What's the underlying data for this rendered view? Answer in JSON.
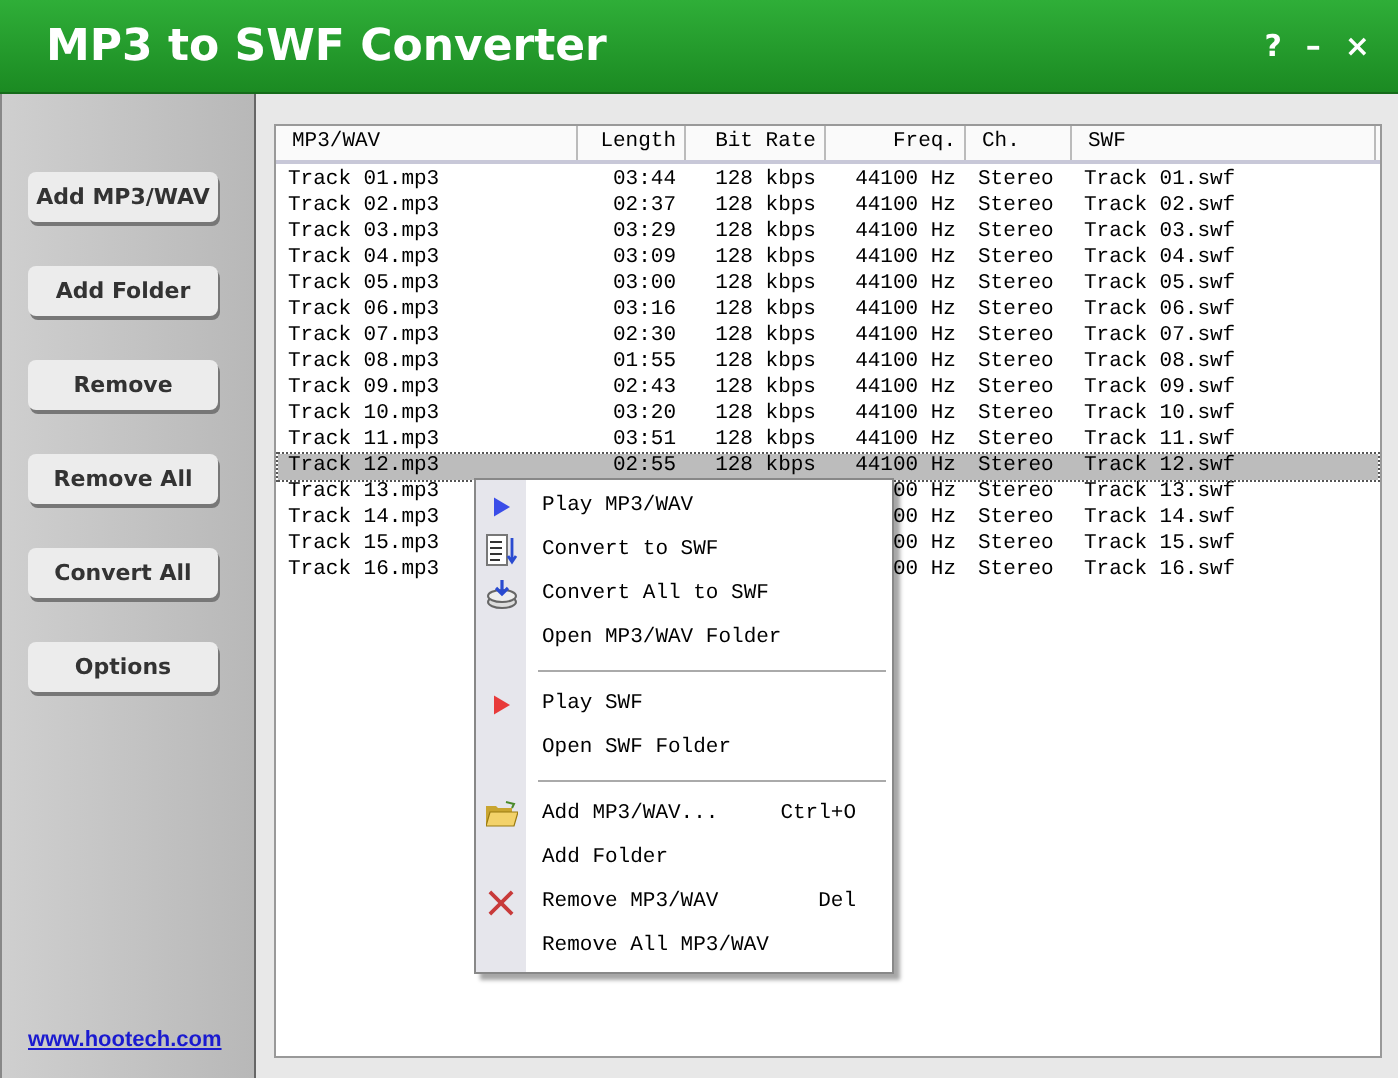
{
  "window": {
    "title": "MP3 to SWF Converter",
    "controls": [
      "?",
      "–",
      "×"
    ]
  },
  "sidebar": {
    "buttons": [
      "Add MP3/WAV",
      "Add Folder",
      "Remove",
      "Remove All",
      "Convert All",
      "Options"
    ],
    "link": "www.hootech.com"
  },
  "table": {
    "columns": [
      "MP3/WAV",
      "Length",
      "Bit Rate",
      "Freq.",
      "Ch.",
      "SWF"
    ],
    "rows": [
      {
        "selected": false,
        "cells": [
          "Track 01.mp3",
          "03:44",
          "128 kbps",
          "44100 Hz",
          "Stereo",
          "Track 01.swf"
        ]
      },
      {
        "selected": false,
        "cells": [
          "Track 02.mp3",
          "02:37",
          "128 kbps",
          "44100 Hz",
          "Stereo",
          "Track 02.swf"
        ]
      },
      {
        "selected": false,
        "cells": [
          "Track 03.mp3",
          "03:29",
          "128 kbps",
          "44100 Hz",
          "Stereo",
          "Track 03.swf"
        ]
      },
      {
        "selected": false,
        "cells": [
          "Track 04.mp3",
          "03:09",
          "128 kbps",
          "44100 Hz",
          "Stereo",
          "Track 04.swf"
        ]
      },
      {
        "selected": false,
        "cells": [
          "Track 05.mp3",
          "03:00",
          "128 kbps",
          "44100 Hz",
          "Stereo",
          "Track 05.swf"
        ]
      },
      {
        "selected": false,
        "cells": [
          "Track 06.mp3",
          "03:16",
          "128 kbps",
          "44100 Hz",
          "Stereo",
          "Track 06.swf"
        ]
      },
      {
        "selected": false,
        "cells": [
          "Track 07.mp3",
          "02:30",
          "128 kbps",
          "44100 Hz",
          "Stereo",
          "Track 07.swf"
        ]
      },
      {
        "selected": false,
        "cells": [
          "Track 08.mp3",
          "01:55",
          "128 kbps",
          "44100 Hz",
          "Stereo",
          "Track 08.swf"
        ]
      },
      {
        "selected": false,
        "cells": [
          "Track 09.mp3",
          "02:43",
          "128 kbps",
          "44100 Hz",
          "Stereo",
          "Track 09.swf"
        ]
      },
      {
        "selected": false,
        "cells": [
          "Track 10.mp3",
          "03:20",
          "128 kbps",
          "44100 Hz",
          "Stereo",
          "Track 10.swf"
        ]
      },
      {
        "selected": false,
        "cells": [
          "Track 11.mp3",
          "03:51",
          "128 kbps",
          "44100 Hz",
          "Stereo",
          "Track 11.swf"
        ]
      },
      {
        "selected": true,
        "cells": [
          "Track 12.mp3",
          "02:55",
          "128 kbps",
          "44100 Hz",
          "Stereo",
          "Track 12.swf"
        ]
      },
      {
        "selected": false,
        "cells": [
          "Track 13.mp3",
          "",
          "",
          "00 Hz",
          "Stereo",
          "Track 13.swf"
        ]
      },
      {
        "selected": false,
        "cells": [
          "Track 14.mp3",
          "",
          "",
          "00 Hz",
          "Stereo",
          "Track 14.swf"
        ]
      },
      {
        "selected": false,
        "cells": [
          "Track 15.mp3",
          "",
          "",
          "00 Hz",
          "Stereo",
          "Track 15.swf"
        ]
      },
      {
        "selected": false,
        "cells": [
          "Track 16.mp3",
          "",
          "",
          "00 Hz",
          "Stereo",
          "Track 16.swf"
        ]
      }
    ]
  },
  "context_menu": {
    "items": [
      {
        "kind": "item",
        "label": "Play MP3/WAV"
      },
      {
        "kind": "item",
        "label": "Convert to SWF"
      },
      {
        "kind": "item",
        "label": "Convert All to SWF"
      },
      {
        "kind": "item",
        "label": "Open MP3/WAV Folder"
      },
      {
        "kind": "separator"
      },
      {
        "kind": "item",
        "label": "Play SWF"
      },
      {
        "kind": "item",
        "label": "Open SWF Folder"
      },
      {
        "kind": "separator"
      },
      {
        "kind": "item",
        "label": "Add MP3/WAV...",
        "shortcut": "Ctrl+O"
      },
      {
        "kind": "item",
        "label": "Add Folder"
      },
      {
        "kind": "item",
        "label": "Remove MP3/WAV",
        "shortcut": "Del"
      },
      {
        "kind": "item",
        "label": "Remove All MP3/WAV"
      }
    ]
  }
}
